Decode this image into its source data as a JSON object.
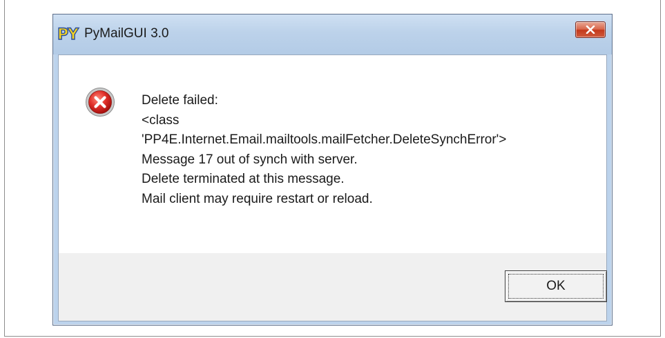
{
  "window": {
    "title": "PyMailGUI 3.0",
    "icon": "python-logo-icon"
  },
  "titlebar_buttons": {
    "close_icon": "close-icon"
  },
  "message": {
    "icon": "error-icon",
    "lines": [
      "Delete failed:",
      "<class",
      "'PP4E.Internet.Email.mailtools.mailFetcher.DeleteSynchError'>",
      "Message 17 out of synch with server.",
      "Delete terminated at this message.",
      "Mail client may require restart or reload."
    ]
  },
  "buttons": {
    "ok_label": "OK"
  },
  "colors": {
    "titlebar": "#bcd2ea",
    "close_button": "#c4391b",
    "error_icon": "#d42020",
    "button_area": "#f0f0f0"
  }
}
